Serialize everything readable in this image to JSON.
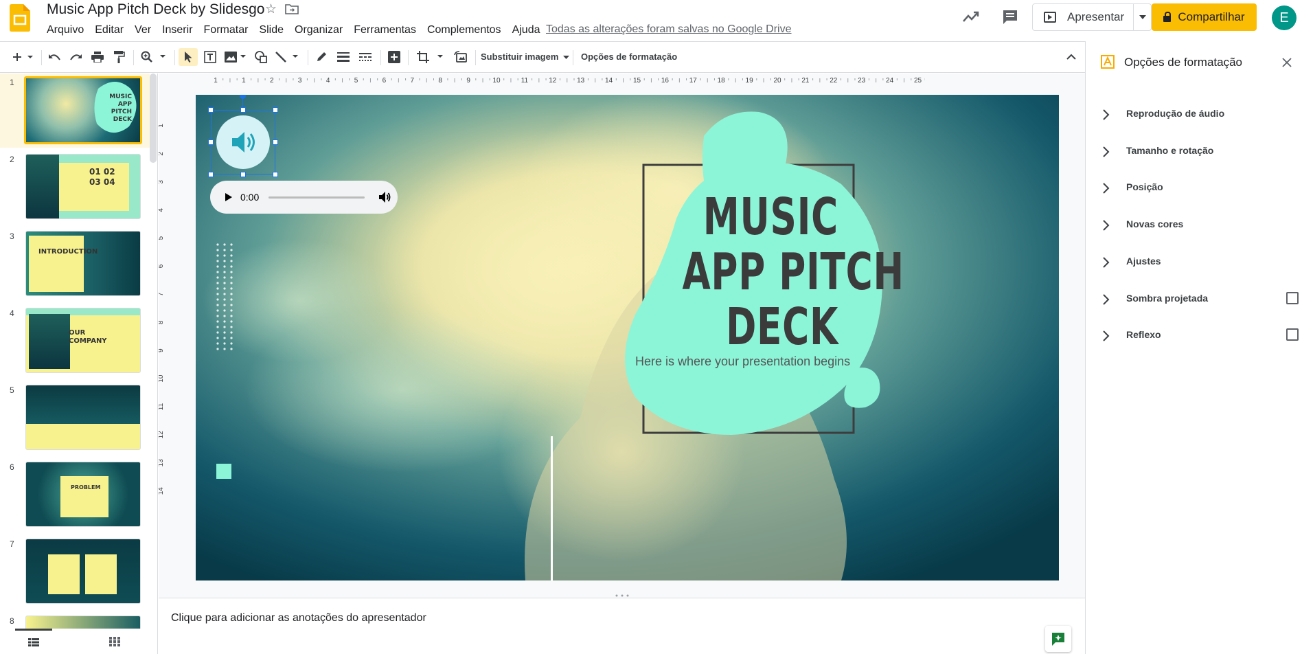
{
  "header": {
    "title": "Music App Pitch Deck by Slidesgo",
    "menu": [
      "Arquivo",
      "Editar",
      "Ver",
      "Inserir",
      "Formatar",
      "Slide",
      "Organizar",
      "Ferramentas",
      "Complementos",
      "Ajuda"
    ],
    "save_status": "Todas as alterações foram salvas no Google Drive",
    "present_label": "Apresentar",
    "share_label": "Compartilhar",
    "avatar_initial": "E"
  },
  "toolbar": {
    "replace_image_label": "Substituir imagem",
    "format_options_label": "Opções de formatação"
  },
  "rulers": {
    "top_ticks": [
      "1",
      "1",
      "2",
      "3",
      "4",
      "5",
      "6",
      "7",
      "8",
      "9",
      "10",
      "11",
      "12",
      "13",
      "14",
      "15",
      "16",
      "17",
      "18",
      "19",
      "20",
      "21",
      "22",
      "23",
      "24",
      "25"
    ],
    "left_ticks": [
      "1",
      "2",
      "3",
      "4",
      "5",
      "6",
      "7",
      "8",
      "9",
      "10",
      "11",
      "12",
      "13",
      "14"
    ]
  },
  "filmstrip": {
    "slides": [
      {
        "number": "1",
        "label": "MUSIC APP PITCH DECK",
        "active": true
      },
      {
        "number": "2",
        "label": "01 02 03 04"
      },
      {
        "number": "3",
        "label": "INTRODUCTION"
      },
      {
        "number": "4",
        "label": "OUR COMPANY"
      },
      {
        "number": "5",
        "label": ""
      },
      {
        "number": "6",
        "label": "PROBLEM"
      },
      {
        "number": "7",
        "label": ""
      },
      {
        "number": "8",
        "label": ""
      }
    ]
  },
  "slide": {
    "title_line1": "MUSIC",
    "title_line2": "APP PITCH",
    "title_line3": "DECK",
    "subtitle": "Here is where your presentation begins",
    "audio_time": "0:00"
  },
  "notes": {
    "placeholder": "Clique para adicionar as anotações do apresentador"
  },
  "format_panel": {
    "title": "Opções de formatação",
    "sections": [
      {
        "label": "Reprodução de áudio",
        "has_checkbox": false
      },
      {
        "label": "Tamanho e rotação",
        "has_checkbox": false
      },
      {
        "label": "Posição",
        "has_checkbox": false
      },
      {
        "label": "Novas cores",
        "has_checkbox": false
      },
      {
        "label": "Ajustes",
        "has_checkbox": false
      },
      {
        "label": "Sombra projetada",
        "has_checkbox": true
      },
      {
        "label": "Reflexo",
        "has_checkbox": true
      }
    ]
  },
  "colors": {
    "accent_yellow": "#fbbc04",
    "mint": "#8cf5d8",
    "teal_dark": "#0b4a55",
    "smoke": "#f5ecaa"
  }
}
